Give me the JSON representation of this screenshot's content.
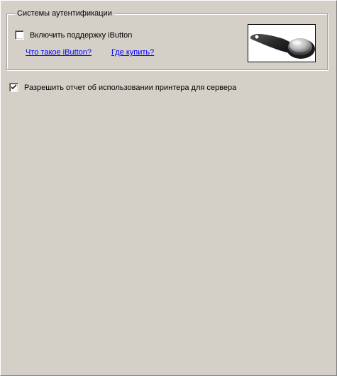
{
  "auth_group": {
    "title": "Системы аутентификации",
    "ibutton_checkbox_label": "Включить поддержку iButton",
    "ibutton_checked": false,
    "what_is_link": "Что такое iButton?",
    "where_to_buy_link": "Где купить?",
    "image_icon": "ibutton-key-fob-image"
  },
  "printer_report": {
    "label": "Разрешить отчет об использовании принтера для сервера",
    "checked": true
  },
  "colors": {
    "background": "#d4d0c8",
    "link": "#0000ff",
    "checkbox_fill": "#ffffff"
  }
}
